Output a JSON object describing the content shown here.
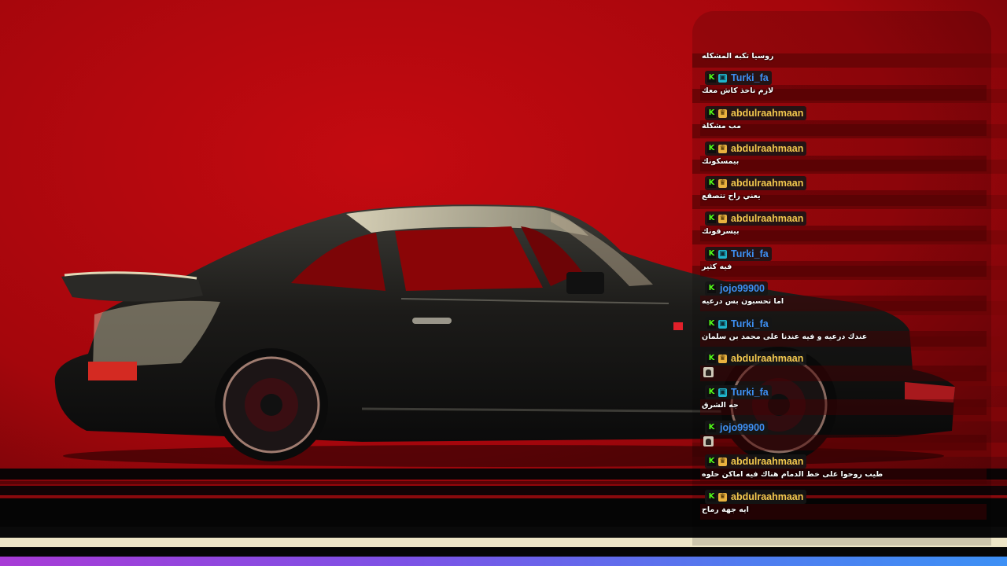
{
  "colors": {
    "background_red": "#b8050c",
    "k_badge": "#53fc18",
    "username_blue": "#3d8ff2",
    "username_gold": "#f2c84e"
  },
  "chat": {
    "top_message": "روسيا تكبه المشكله",
    "messages": [
      {
        "username": "Turki_fa",
        "sub_badge": "gift-badge-icon",
        "color": "#3d8ff2",
        "text": "لازم تاخذ كاش معك"
      },
      {
        "username": "abdulraahmaan",
        "sub_badge": "crown-badge-icon",
        "color": "#f2c84e",
        "text": "مب مشكلة"
      },
      {
        "username": "abdulraahmaan",
        "sub_badge": "crown-badge-icon",
        "color": "#f2c84e",
        "text": "بيمسكونك"
      },
      {
        "username": "abdulraahmaan",
        "sub_badge": "crown-badge-icon",
        "color": "#f2c84e",
        "text": "يعني راح تتصقع"
      },
      {
        "username": "abdulraahmaan",
        "sub_badge": "crown-badge-icon",
        "color": "#f2c84e",
        "text": "بيسرقونك"
      },
      {
        "username": "Turki_fa",
        "sub_badge": "gift-badge-icon",
        "color": "#3d8ff2",
        "text": "فيه كثير"
      },
      {
        "username": "jojo99900",
        "sub_badge": "",
        "color": "#3d8ff2",
        "text": "اما تحسبون بس درعيه"
      },
      {
        "username": "Turki_fa",
        "sub_badge": "gift-badge-icon",
        "color": "#3d8ff2",
        "text": "عندك درعيه و فيه عندنا على محمد بن سلمان"
      },
      {
        "username": "abdulraahmaan",
        "sub_badge": "crown-badge-icon",
        "color": "#f2c84e",
        "text": "",
        "emote": "face-emote-icon"
      },
      {
        "username": "Turki_fa",
        "sub_badge": "gift-badge-icon",
        "color": "#3d8ff2",
        "text": "جه الشرق"
      },
      {
        "username": "jojo99900",
        "sub_badge": "",
        "color": "#3d8ff2",
        "text": "",
        "emote": "face-emote-icon"
      },
      {
        "username": "abdulraahmaan",
        "sub_badge": "crown-badge-icon",
        "color": "#f2c84e",
        "text": "طيب روحوا على خط الدمام هناك فيه اماكن حلوه"
      },
      {
        "username": "abdulraahmaan",
        "sub_badge": "crown-badge-icon",
        "color": "#f2c84e",
        "text": "ايه جهة رماح"
      }
    ]
  }
}
